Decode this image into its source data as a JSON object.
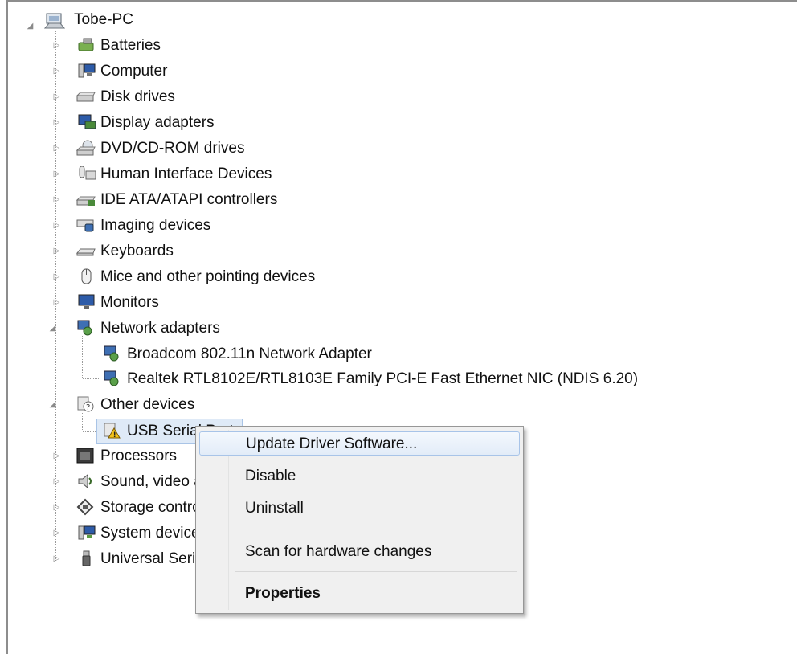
{
  "root": {
    "label": "Tobe-PC",
    "icon": "computer-tower-icon"
  },
  "tree": [
    {
      "label": "Batteries",
      "icon": "battery-icon",
      "expanded": false
    },
    {
      "label": "Computer",
      "icon": "computer-icon",
      "expanded": false
    },
    {
      "label": "Disk drives",
      "icon": "disk-drive-icon",
      "expanded": false
    },
    {
      "label": "Display adapters",
      "icon": "display-adapter-icon",
      "expanded": false
    },
    {
      "label": "DVD/CD-ROM drives",
      "icon": "dvd-drive-icon",
      "expanded": false
    },
    {
      "label": "Human Interface Devices",
      "icon": "hid-icon",
      "expanded": false
    },
    {
      "label": "IDE ATA/ATAPI controllers",
      "icon": "ide-controller-icon",
      "expanded": false
    },
    {
      "label": "Imaging devices",
      "icon": "imaging-device-icon",
      "expanded": false
    },
    {
      "label": "Keyboards",
      "icon": "keyboard-icon",
      "expanded": false
    },
    {
      "label": "Mice and other pointing devices",
      "icon": "mouse-icon",
      "expanded": false
    },
    {
      "label": "Monitors",
      "icon": "monitor-icon",
      "expanded": false
    },
    {
      "label": "Network adapters",
      "icon": "network-adapter-icon",
      "expanded": true,
      "children": [
        {
          "label": "Broadcom 802.11n Network Adapter",
          "icon": "network-adapter-icon"
        },
        {
          "label": "Realtek RTL8102E/RTL8103E Family PCI-E Fast Ethernet NIC (NDIS 6.20)",
          "icon": "network-adapter-icon"
        }
      ]
    },
    {
      "label": "Other devices",
      "icon": "unknown-device-icon",
      "expanded": true,
      "children": [
        {
          "label": "USB Serial Port",
          "icon": "warning-device-icon",
          "selected": true
        }
      ]
    },
    {
      "label": "Processors",
      "icon": "processor-icon",
      "expanded": false
    },
    {
      "label": "Sound, video and game controllers",
      "icon": "speaker-icon",
      "expanded": false
    },
    {
      "label": "Storage controllers",
      "icon": "storage-controller-icon",
      "expanded": false
    },
    {
      "label": "System devices",
      "icon": "system-device-icon",
      "expanded": false
    },
    {
      "label": "Universal Serial Bus controllers",
      "icon": "usb-icon",
      "expanded": false
    }
  ],
  "context_menu": {
    "update_driver": "Update Driver Software...",
    "disable": "Disable",
    "uninstall": "Uninstall",
    "scan": "Scan for hardware changes",
    "properties": "Properties"
  },
  "colors": {
    "selection": "#dfeaf7",
    "menu_bg": "#f0f0f0",
    "highlight_border": "#a8c4e8"
  }
}
